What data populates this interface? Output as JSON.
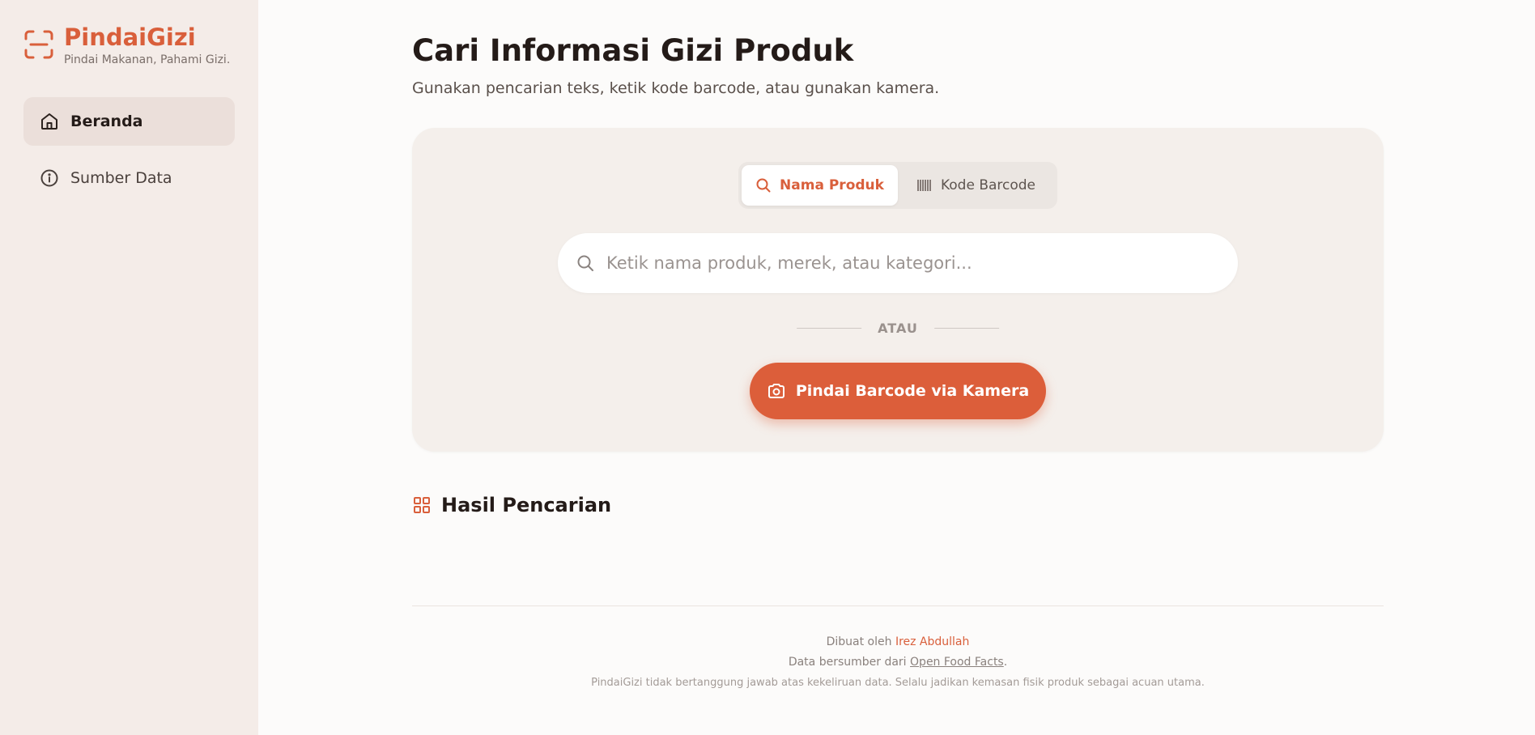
{
  "brand": {
    "name": "PindaiGizi",
    "tagline": "Pindai Makanan, Pahami Gizi."
  },
  "nav": [
    {
      "label": "Beranda",
      "icon": "home-icon",
      "active": true
    },
    {
      "label": "Sumber Data",
      "icon": "info-icon",
      "active": false
    }
  ],
  "page": {
    "title": "Cari Informasi Gizi Produk",
    "subtitle": "Gunakan pencarian teks, ketik kode barcode, atau gunakan kamera."
  },
  "search": {
    "tabs": [
      {
        "label": "Nama Produk",
        "icon": "search-icon",
        "active": true
      },
      {
        "label": "Kode Barcode",
        "icon": "barcode-icon",
        "active": false
      }
    ],
    "placeholder": "Ketik nama produk, merek, atau kategori...",
    "value": "",
    "divider": "ATAU",
    "camera_button": "Pindai Barcode via Kamera"
  },
  "results": {
    "title": "Hasil Pencarian"
  },
  "footer": {
    "made_by_prefix": "Dibuat oleh ",
    "author": "Irez Abdullah",
    "source_prefix": "Data bersumber dari ",
    "source_link": "Open Food Facts",
    "source_suffix": ".",
    "disclaimer": "PindaiGizi tidak bertanggung jawab atas kekeliruan data. Selalu jadikan kemasan fisik produk sebagai acuan utama."
  },
  "colors": {
    "accent": "#d95f3b",
    "sidebar_bg": "#f4ece8",
    "card_bg": "#f4efeb"
  }
}
